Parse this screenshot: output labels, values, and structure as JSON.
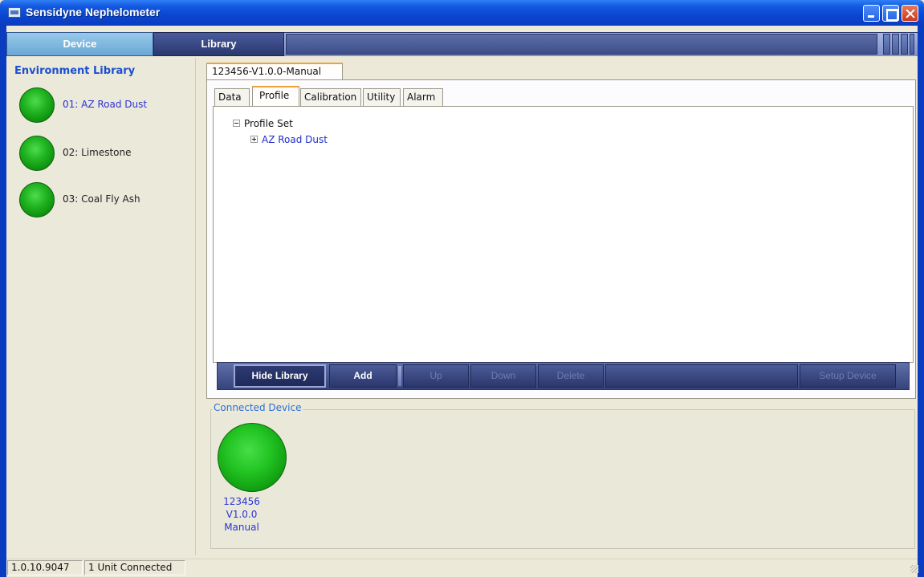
{
  "window": {
    "title": "Sensidyne Nephelometer"
  },
  "nav": {
    "device_label": "Device",
    "library_label": "Library"
  },
  "library": {
    "title": "Environment Library",
    "items": [
      {
        "label": "01: AZ Road Dust",
        "selected": true
      },
      {
        "label": "02: Limestone",
        "selected": false
      },
      {
        "label": "03: Coal Fly Ash",
        "selected": false
      }
    ]
  },
  "device_tab": {
    "label": "123456-V1.0.0-Manual"
  },
  "subtabs": [
    {
      "label": "Data",
      "active": false
    },
    {
      "label": "Profile",
      "active": true
    },
    {
      "label": "Calibration",
      "active": false
    },
    {
      "label": "Utility",
      "active": false
    },
    {
      "label": "Alarm",
      "active": false
    }
  ],
  "profile_tree": {
    "root": "Profile Set",
    "children": [
      "AZ Road Dust"
    ]
  },
  "toolbar": {
    "hide_library": "Hide Library",
    "add": "Add",
    "up": "Up",
    "down": "Down",
    "delete": "Delete",
    "setup_device": "Setup Device"
  },
  "connected": {
    "title": "Connected Device",
    "device_id": "123456",
    "version": "V1.0.0",
    "mode": "Manual"
  },
  "status": {
    "version": "1.0.10.9047",
    "units": "1 Unit Connected"
  },
  "colors": {
    "title_bar": "#0a46d1",
    "accent_blue": "#2b33d6",
    "status_green": "#22c422",
    "tab_highlight": "#f0a23a"
  }
}
